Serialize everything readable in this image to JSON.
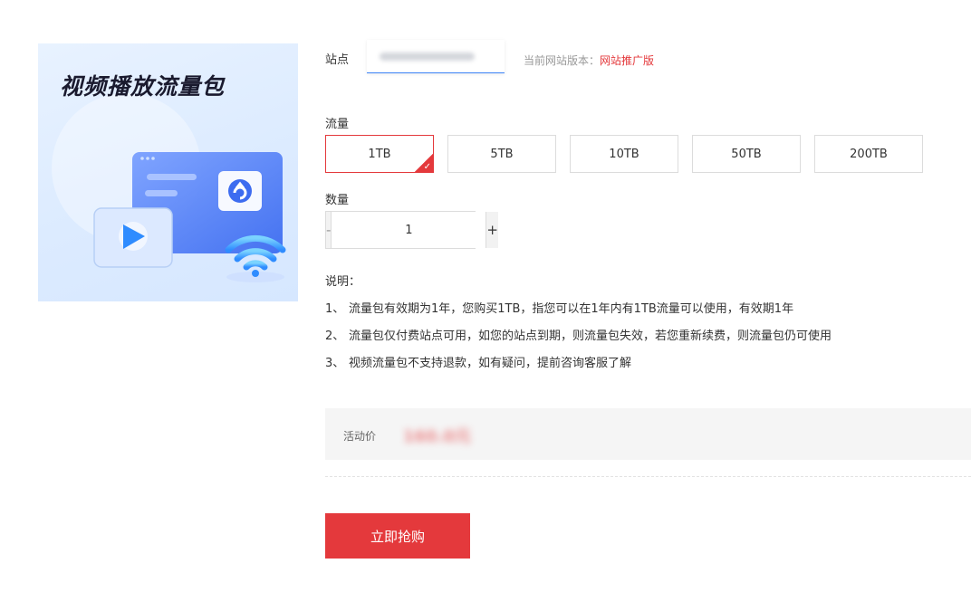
{
  "product": {
    "title": "视频播放流量包",
    "image_icons": [
      "play-icon",
      "upload-icon",
      "wifi-icon"
    ]
  },
  "site": {
    "label": "站点",
    "selected_value_blurred": "",
    "version_prefix": "当前网站版本：",
    "version_value": "网站推广版"
  },
  "traffic": {
    "label": "流量",
    "options": [
      "1TB",
      "5TB",
      "10TB",
      "50TB",
      "200TB"
    ],
    "selected_index": 0
  },
  "quantity": {
    "label": "数量",
    "minus": "-",
    "value": "1",
    "plus": "+"
  },
  "description": {
    "title": "说明：",
    "items": [
      {
        "num": "1、",
        "text": "流量包有效期为1年，您购买1TB，指您可以在1年内有1TB流量可以使用，有效期1年"
      },
      {
        "num": "2、",
        "text": "流量包仅付费站点可用，如您的站点到期，则流量包失效，若您重新续费，则流量包仍可使用"
      },
      {
        "num": "3、",
        "text": "视频流量包不支持退款，如有疑问，提前咨询客服了解"
      }
    ]
  },
  "price": {
    "label": "活动价",
    "value_blurred": "160.0元"
  },
  "buy_button": "立即抢购",
  "colors": {
    "accent": "#e4393c",
    "link_underline": "#3b82f6",
    "price_bar_bg": "#f5f5f5"
  }
}
